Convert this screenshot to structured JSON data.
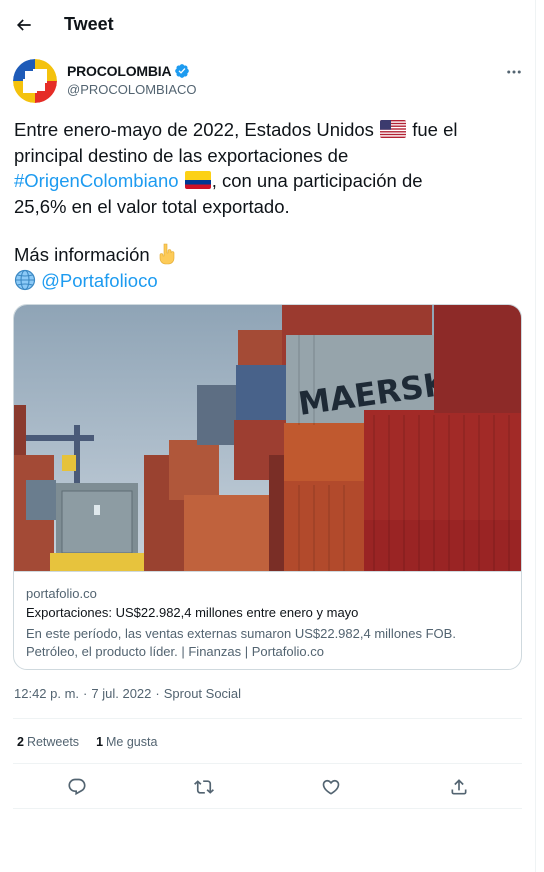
{
  "header": {
    "title": "Tweet"
  },
  "author": {
    "name": "PROCOLOMBIA",
    "handle": "@PROCOLOMBIACO"
  },
  "tweet": {
    "line1_a": "Entre enero-mayo de 2022, Estados Unidos",
    "line1_b": "fue el",
    "line2": "principal destino de las exportaciones de",
    "hashtag": "#OrigenColombiano",
    "line3_b": ", con una participación de",
    "line4": "25,6% en el valor total exportado.",
    "more_info": "Más información",
    "mention": "@Portafolioco"
  },
  "card": {
    "domain": "portafolio.co",
    "title": "Exportaciones: US$22.982,4 millones entre enero y mayo",
    "description": "En este período, las ventas externas sumaron US$22.982,4 millones FOB. Petróleo, el producto líder. | Finanzas | Portafolio.co",
    "image_text": "MAERSK"
  },
  "meta": {
    "time": "12:42 p. m.",
    "separator1": "·",
    "date": "7 jul. 2022",
    "separator2": "·",
    "source": "Sprout Social"
  },
  "stats": {
    "retweets_count": "2",
    "retweets_label": "Retweets",
    "likes_count": "1",
    "likes_label": "Me gusta"
  },
  "colors": {
    "accent": "#1d9bf0",
    "text": "#0f1419",
    "muted": "#536471",
    "border": "#cfd9de"
  },
  "icons": [
    "back-arrow-icon",
    "verified-icon",
    "more-icon",
    "us-flag-icon",
    "colombia-flag-icon",
    "pointing-down-icon",
    "globe-icon",
    "reply-icon",
    "retweet-icon",
    "like-icon",
    "share-icon"
  ]
}
